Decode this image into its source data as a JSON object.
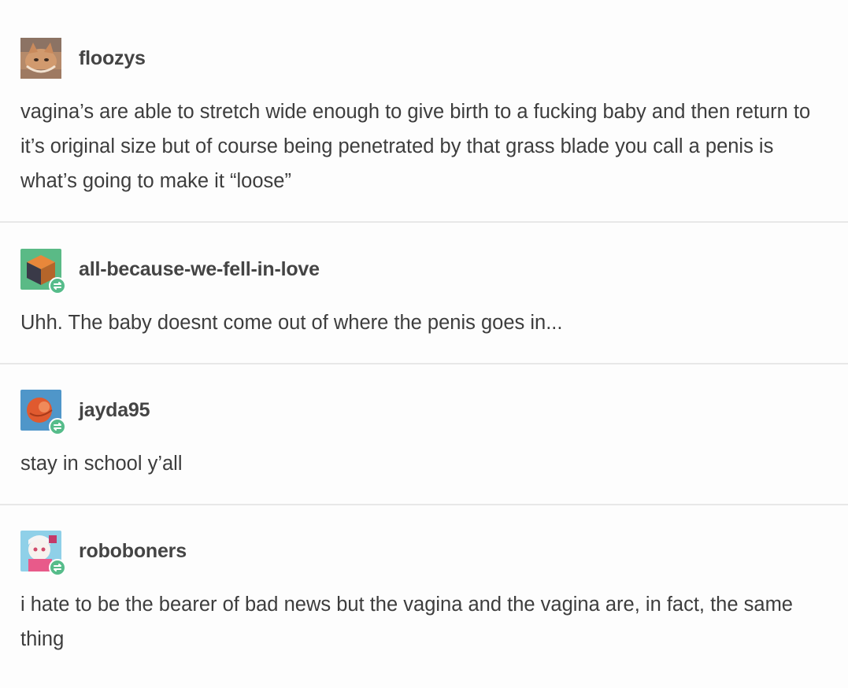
{
  "posts": [
    {
      "username": "floozys",
      "avatar_icon": "cat-photo-icon",
      "reblog": false,
      "body": "vagina’s are able to stretch wide enough to give birth to a fucking baby and then return to it’s original size but of course being penetrated by that grass blade you call a penis is what’s going to make it “loose”"
    },
    {
      "username": "all-because-we-fell-in-love",
      "avatar_icon": "cube-icon",
      "reblog": true,
      "body": "Uhh. The baby doesnt come out of where the penis goes in..."
    },
    {
      "username": "jayda95",
      "avatar_icon": "orange-planet-icon",
      "reblog": true,
      "body": "stay in school y’all"
    },
    {
      "username": "roboboners",
      "avatar_icon": "anime-character-icon",
      "reblog": true,
      "body": "i hate to be the bearer of bad news but the vagina and the vagina are, in fact, the same thing"
    }
  ],
  "colors": {
    "reblog_badge": "#56bc8a",
    "divider": "#e8e8e8",
    "username": "#444444",
    "body_text": "#3d3d3d"
  }
}
